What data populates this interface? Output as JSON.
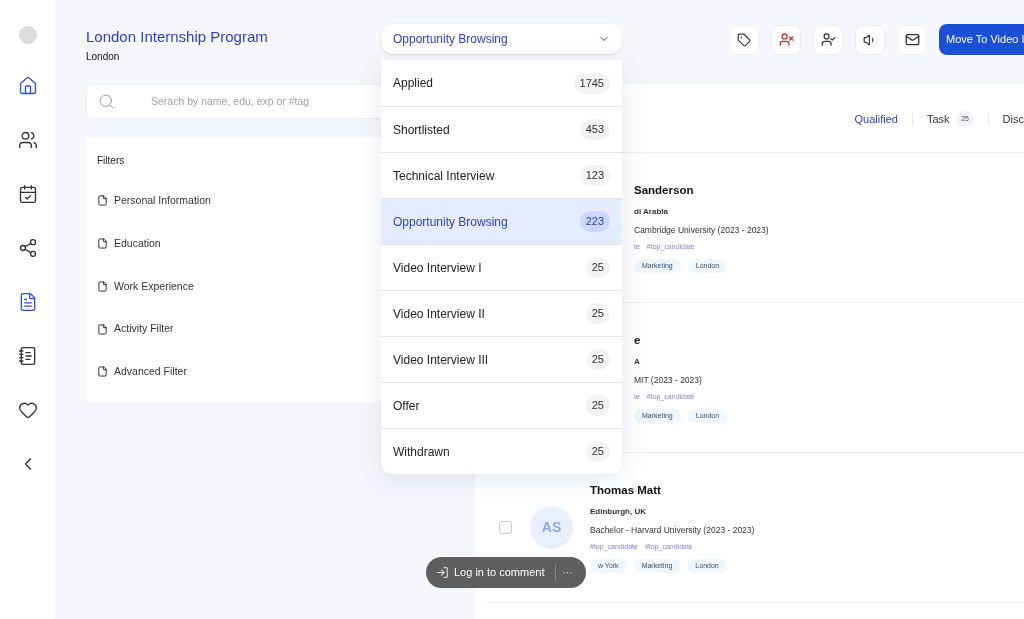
{
  "sidebar": {
    "items": [
      {
        "selected": true
      },
      {
        "selected": false
      },
      {
        "selected": false
      },
      {
        "selected": false
      },
      {
        "selected": true
      },
      {
        "selected": false
      },
      {
        "selected": false
      },
      {
        "selected": false
      }
    ]
  },
  "header": {
    "title": "London Internship Program",
    "subtitle": "London",
    "primary_button": "Move To Video I"
  },
  "search": {
    "placeholder": "Serach by name, edu, exp or #tag"
  },
  "filters": {
    "title": "Filters",
    "items": [
      "Personal Information",
      "Education",
      "Work Experience",
      "Activity Filter",
      "Advanced Filter"
    ]
  },
  "stage_dropdown": {
    "value": "Opportunity Browsing",
    "options": [
      {
        "label": "Applied",
        "count": "1745",
        "selected": false
      },
      {
        "label": "Shortlisted",
        "count": "453",
        "selected": false
      },
      {
        "label": "Technical Interview",
        "count": "123",
        "selected": false
      },
      {
        "label": "Opportunity Browsing",
        "count": "223",
        "selected": true
      },
      {
        "label": "Video Interview I",
        "count": "25",
        "selected": false
      },
      {
        "label": "Video Interview II",
        "count": "25",
        "selected": false
      },
      {
        "label": "Video Interview III",
        "count": "25",
        "selected": false
      },
      {
        "label": "Offer",
        "count": "25",
        "selected": false
      },
      {
        "label": "Withdrawn",
        "count": "25",
        "selected": false
      }
    ]
  },
  "tabs": [
    {
      "label": "Qualified",
      "selected": true
    },
    {
      "label": "Task",
      "count": "25",
      "selected": false
    },
    {
      "label": "Disc",
      "selected": false
    }
  ],
  "candidates": [
    {
      "name": "Sanderson",
      "location": "di Arabia",
      "education": "Cambridge University (2023 - 2023)",
      "hashtags": [
        "te",
        "#top_candidate"
      ],
      "chips": [
        "Marketing",
        "London"
      ]
    },
    {
      "name": "e",
      "location": "A",
      "education": "MIT (2023 - 2023)",
      "hashtags": [
        "te",
        "#top_candidate"
      ],
      "chips": [
        "Marketing",
        "London"
      ]
    },
    {
      "name": "Thomas Matt",
      "location": "Edinburgh, UK",
      "education": "Bachelor - Harvard University (2023 - 2023)",
      "avatar": "AS",
      "checked": false,
      "hashtags": [
        "#top_candidate",
        "#top_candidate"
      ],
      "chips": [
        "w York",
        "Marketing",
        "London"
      ]
    }
  ],
  "toast": {
    "label": "Log in to comment",
    "more": "···"
  }
}
